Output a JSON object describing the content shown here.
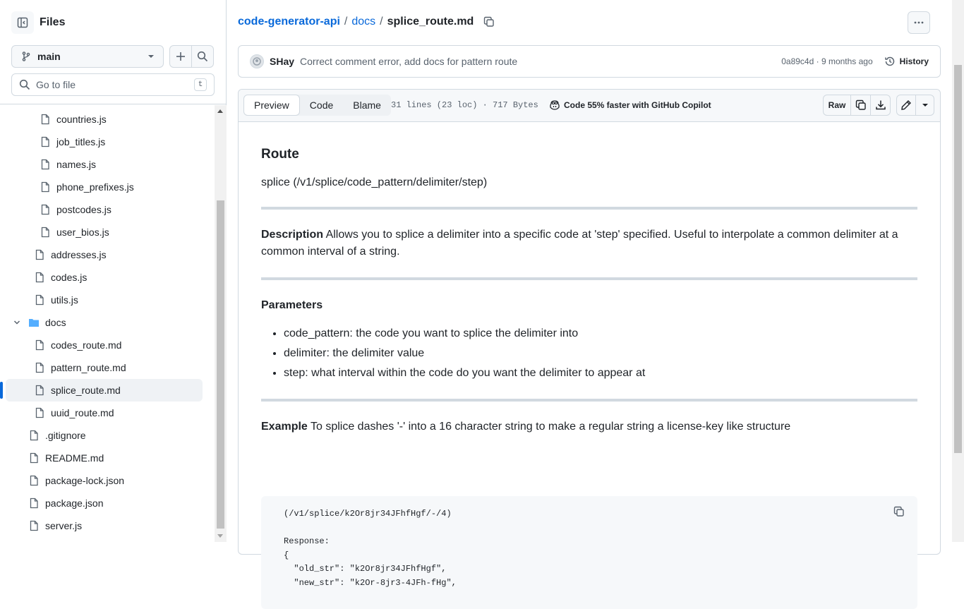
{
  "sidebar": {
    "title": "Files",
    "branch": "main",
    "goto_placeholder": "Go to file",
    "goto_shortcut": "t",
    "tree": [
      {
        "label": "countries.js",
        "type": "file",
        "depth": 2
      },
      {
        "label": "job_titles.js",
        "type": "file",
        "depth": 2
      },
      {
        "label": "names.js",
        "type": "file",
        "depth": 2
      },
      {
        "label": "phone_prefixes.js",
        "type": "file",
        "depth": 2
      },
      {
        "label": "postcodes.js",
        "type": "file",
        "depth": 2
      },
      {
        "label": "user_bios.js",
        "type": "file",
        "depth": 2
      },
      {
        "label": "addresses.js",
        "type": "file",
        "depth": 1
      },
      {
        "label": "codes.js",
        "type": "file",
        "depth": 1
      },
      {
        "label": "utils.js",
        "type": "file",
        "depth": 1
      },
      {
        "label": "docs",
        "type": "folder",
        "depth": 0
      },
      {
        "label": "codes_route.md",
        "type": "file",
        "depth": 1
      },
      {
        "label": "pattern_route.md",
        "type": "file",
        "depth": 1
      },
      {
        "label": "splice_route.md",
        "type": "file",
        "depth": 1,
        "selected": true
      },
      {
        "label": "uuid_route.md",
        "type": "file",
        "depth": 1
      },
      {
        "label": ".gitignore",
        "type": "file",
        "depth": 0
      },
      {
        "label": "README.md",
        "type": "file",
        "depth": 0
      },
      {
        "label": "package-lock.json",
        "type": "file",
        "depth": 0
      },
      {
        "label": "package.json",
        "type": "file",
        "depth": 0
      },
      {
        "label": "server.js",
        "type": "file",
        "depth": 0
      }
    ]
  },
  "breadcrumb": {
    "repo": "code-generator-api",
    "sep1": "/",
    "folder": "docs",
    "sep2": "/",
    "file": "splice_route.md"
  },
  "commit": {
    "author": "SHay",
    "message": "Correct comment error, add docs for pattern route",
    "meta": "0a89c4d · 9 months ago",
    "history_label": "History"
  },
  "file_header": {
    "tabs": [
      "Preview",
      "Code",
      "Blame"
    ],
    "active_tab": "Preview",
    "lines_info": "31 lines (23 loc) · 717 Bytes",
    "copilot": "Code 55% faster with GitHub Copilot",
    "raw_label": "Raw"
  },
  "markdown": {
    "heading": "Route",
    "route": "splice (/v1/splice/code_pattern/delimiter/step)",
    "desc_label": "Description",
    "desc_text": " Allows you to splice a delimiter into a specific code at 'step' specified. Useful to interpolate a common delimiter at a common interval of a string.",
    "params_label": "Parameters",
    "params": [
      "code_pattern: the code you want to splice the delimiter into",
      "delimiter: the delimiter value",
      "step: what interval within the code do you want the delimiter to appear at"
    ],
    "example_label": "Example",
    "example_text": " To splice dashes '-' into a 16 character string to make a regular string a license-key like structure",
    "code": "(/v1/splice/k2Or8jr34JFhfHgf/-/4)\n\nResponse:\n{\n  \"old_str\": \"k2Or8jr34JFhfHgf\",\n  \"new_str\": \"k2Or-8jr3-4JFh-fHg\","
  }
}
